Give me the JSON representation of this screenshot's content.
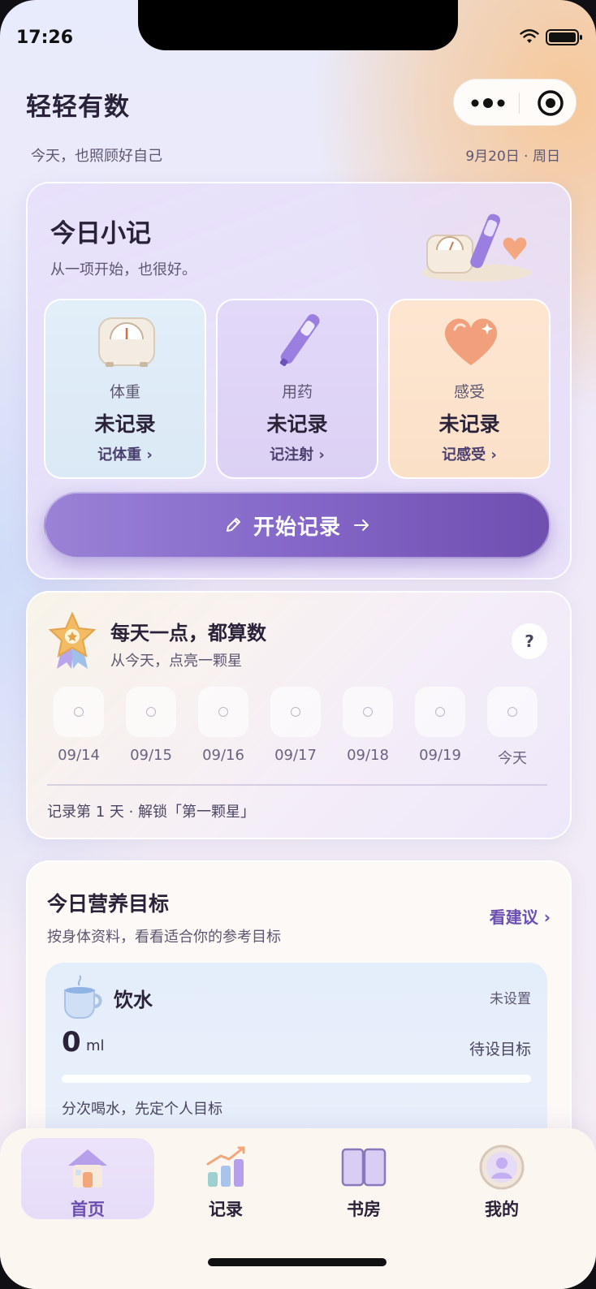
{
  "status_bar": {
    "time": "17:26"
  },
  "header": {
    "app_title": "轻轻有数",
    "subtitle": "今天，也照顾好自己",
    "date": "9月20日 · 周日"
  },
  "today_card": {
    "title": "今日小记",
    "subtitle": "从一项开始，也很好。",
    "tiles": [
      {
        "label": "体重",
        "status": "未记录",
        "action": "记体重 ›",
        "icon": "scale-icon"
      },
      {
        "label": "用药",
        "status": "未记录",
        "action": "记注射 ›",
        "icon": "injection-pen-icon"
      },
      {
        "label": "感受",
        "status": "未记录",
        "action": "记感受 ›",
        "icon": "heart-icon"
      }
    ],
    "start_button": "开始记录"
  },
  "streak_card": {
    "title": "每天一点，都算数",
    "subtitle": "从今天，点亮一颗星",
    "help": "?",
    "days": [
      "09/14",
      "09/15",
      "09/16",
      "09/17",
      "09/18",
      "09/19",
      "今天"
    ],
    "footer": "记录第 1 天 · 解锁「第一颗星」"
  },
  "nutrition_card": {
    "title": "今日营养目标",
    "subtitle": "按身体资料，看看适合你的参考目标",
    "advice_link": "看建议 ›",
    "water": {
      "title": "饮水",
      "status": "未设置",
      "value": "0",
      "unit": "ml",
      "target": "待设目标",
      "progress": 0,
      "tip": "分次喝水，先定个人目标"
    }
  },
  "tab_bar": {
    "tabs": [
      {
        "label": "首页",
        "icon": "home-icon",
        "active": true
      },
      {
        "label": "记录",
        "icon": "chart-icon",
        "active": false
      },
      {
        "label": "书房",
        "icon": "book-icon",
        "active": false
      },
      {
        "label": "我的",
        "icon": "profile-icon",
        "active": false
      }
    ]
  },
  "colors": {
    "accent": "#7a5cc0",
    "weight_tile": "#dfecf7",
    "med_tile": "#dfd4f6",
    "feel_tile": "#fce3cc"
  }
}
